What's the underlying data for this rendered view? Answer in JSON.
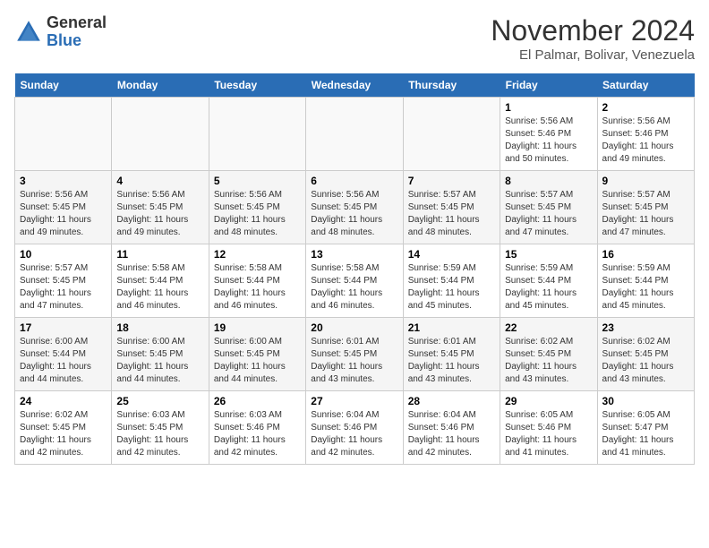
{
  "header": {
    "logo": {
      "line1": "General",
      "line2": "Blue"
    },
    "title": "November 2024",
    "location": "El Palmar, Bolivar, Venezuela"
  },
  "weekdays": [
    "Sunday",
    "Monday",
    "Tuesday",
    "Wednesday",
    "Thursday",
    "Friday",
    "Saturday"
  ],
  "weeks": [
    [
      {
        "day": "",
        "info": ""
      },
      {
        "day": "",
        "info": ""
      },
      {
        "day": "",
        "info": ""
      },
      {
        "day": "",
        "info": ""
      },
      {
        "day": "",
        "info": ""
      },
      {
        "day": "1",
        "info": "Sunrise: 5:56 AM\nSunset: 5:46 PM\nDaylight: 11 hours\nand 50 minutes."
      },
      {
        "day": "2",
        "info": "Sunrise: 5:56 AM\nSunset: 5:46 PM\nDaylight: 11 hours\nand 49 minutes."
      }
    ],
    [
      {
        "day": "3",
        "info": "Sunrise: 5:56 AM\nSunset: 5:45 PM\nDaylight: 11 hours\nand 49 minutes."
      },
      {
        "day": "4",
        "info": "Sunrise: 5:56 AM\nSunset: 5:45 PM\nDaylight: 11 hours\nand 49 minutes."
      },
      {
        "day": "5",
        "info": "Sunrise: 5:56 AM\nSunset: 5:45 PM\nDaylight: 11 hours\nand 48 minutes."
      },
      {
        "day": "6",
        "info": "Sunrise: 5:56 AM\nSunset: 5:45 PM\nDaylight: 11 hours\nand 48 minutes."
      },
      {
        "day": "7",
        "info": "Sunrise: 5:57 AM\nSunset: 5:45 PM\nDaylight: 11 hours\nand 48 minutes."
      },
      {
        "day": "8",
        "info": "Sunrise: 5:57 AM\nSunset: 5:45 PM\nDaylight: 11 hours\nand 47 minutes."
      },
      {
        "day": "9",
        "info": "Sunrise: 5:57 AM\nSunset: 5:45 PM\nDaylight: 11 hours\nand 47 minutes."
      }
    ],
    [
      {
        "day": "10",
        "info": "Sunrise: 5:57 AM\nSunset: 5:45 PM\nDaylight: 11 hours\nand 47 minutes."
      },
      {
        "day": "11",
        "info": "Sunrise: 5:58 AM\nSunset: 5:44 PM\nDaylight: 11 hours\nand 46 minutes."
      },
      {
        "day": "12",
        "info": "Sunrise: 5:58 AM\nSunset: 5:44 PM\nDaylight: 11 hours\nand 46 minutes."
      },
      {
        "day": "13",
        "info": "Sunrise: 5:58 AM\nSunset: 5:44 PM\nDaylight: 11 hours\nand 46 minutes."
      },
      {
        "day": "14",
        "info": "Sunrise: 5:59 AM\nSunset: 5:44 PM\nDaylight: 11 hours\nand 45 minutes."
      },
      {
        "day": "15",
        "info": "Sunrise: 5:59 AM\nSunset: 5:44 PM\nDaylight: 11 hours\nand 45 minutes."
      },
      {
        "day": "16",
        "info": "Sunrise: 5:59 AM\nSunset: 5:44 PM\nDaylight: 11 hours\nand 45 minutes."
      }
    ],
    [
      {
        "day": "17",
        "info": "Sunrise: 6:00 AM\nSunset: 5:44 PM\nDaylight: 11 hours\nand 44 minutes."
      },
      {
        "day": "18",
        "info": "Sunrise: 6:00 AM\nSunset: 5:45 PM\nDaylight: 11 hours\nand 44 minutes."
      },
      {
        "day": "19",
        "info": "Sunrise: 6:00 AM\nSunset: 5:45 PM\nDaylight: 11 hours\nand 44 minutes."
      },
      {
        "day": "20",
        "info": "Sunrise: 6:01 AM\nSunset: 5:45 PM\nDaylight: 11 hours\nand 43 minutes."
      },
      {
        "day": "21",
        "info": "Sunrise: 6:01 AM\nSunset: 5:45 PM\nDaylight: 11 hours\nand 43 minutes."
      },
      {
        "day": "22",
        "info": "Sunrise: 6:02 AM\nSunset: 5:45 PM\nDaylight: 11 hours\nand 43 minutes."
      },
      {
        "day": "23",
        "info": "Sunrise: 6:02 AM\nSunset: 5:45 PM\nDaylight: 11 hours\nand 43 minutes."
      }
    ],
    [
      {
        "day": "24",
        "info": "Sunrise: 6:02 AM\nSunset: 5:45 PM\nDaylight: 11 hours\nand 42 minutes."
      },
      {
        "day": "25",
        "info": "Sunrise: 6:03 AM\nSunset: 5:45 PM\nDaylight: 11 hours\nand 42 minutes."
      },
      {
        "day": "26",
        "info": "Sunrise: 6:03 AM\nSunset: 5:46 PM\nDaylight: 11 hours\nand 42 minutes."
      },
      {
        "day": "27",
        "info": "Sunrise: 6:04 AM\nSunset: 5:46 PM\nDaylight: 11 hours\nand 42 minutes."
      },
      {
        "day": "28",
        "info": "Sunrise: 6:04 AM\nSunset: 5:46 PM\nDaylight: 11 hours\nand 42 minutes."
      },
      {
        "day": "29",
        "info": "Sunrise: 6:05 AM\nSunset: 5:46 PM\nDaylight: 11 hours\nand 41 minutes."
      },
      {
        "day": "30",
        "info": "Sunrise: 6:05 AM\nSunset: 5:47 PM\nDaylight: 11 hours\nand 41 minutes."
      }
    ]
  ]
}
